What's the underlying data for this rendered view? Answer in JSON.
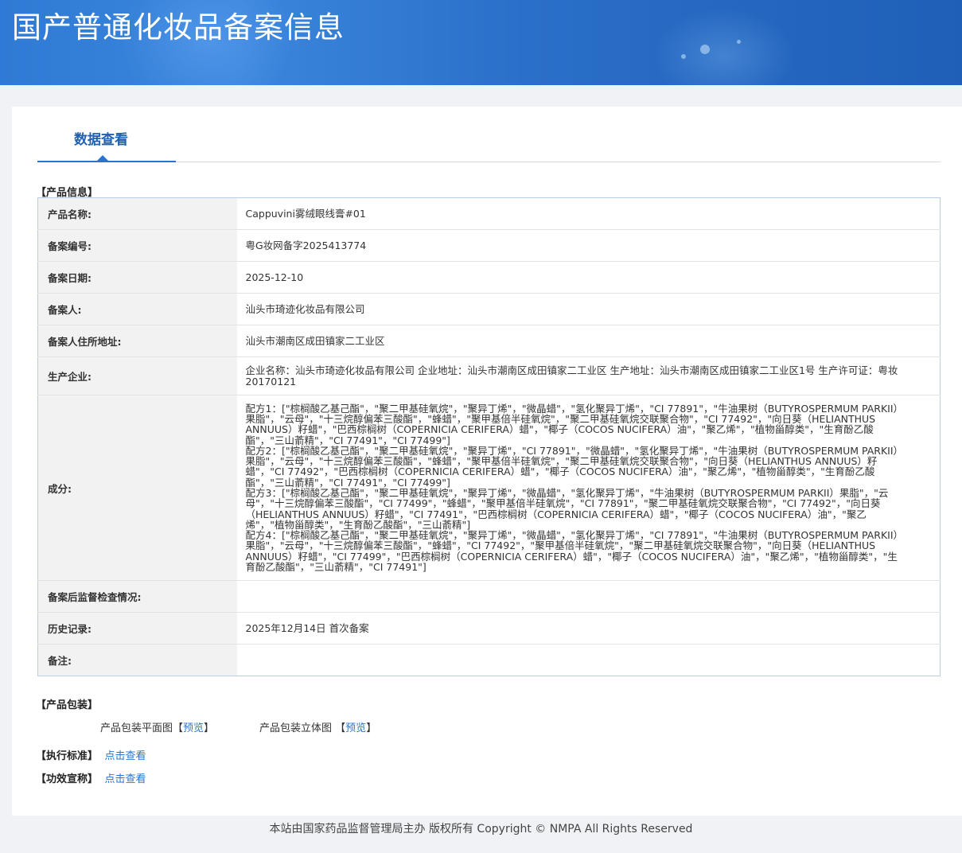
{
  "banner": {
    "title": "国产普通化妆品备案信息"
  },
  "tab": {
    "label": "数据查看"
  },
  "sections": {
    "product_info": "【产品信息】",
    "product_packaging": "【产品包装】",
    "standard": "【执行标准】",
    "efficacy": "【功效宣称】"
  },
  "product_info": {
    "rows": [
      {
        "label": "产品名称:",
        "value": "Cappuvini雾绒眼线膏#01"
      },
      {
        "label": "备案编号:",
        "value": "粤G妆网备字2025413774"
      },
      {
        "label": "备案日期:",
        "value": "2025-12-10"
      },
      {
        "label": "备案人:",
        "value": "汕头市琦迹化妆品有限公司"
      },
      {
        "label": "备案人住所地址:",
        "value": "汕头市潮南区成田镇家二工业区"
      },
      {
        "label": "生产企业:",
        "value": "企业名称：汕头市琦迹化妆品有限公司 企业地址：汕头市潮南区成田镇家二工业区 生产地址：汕头市潮南区成田镇家二工业区1号 生产许可证：粤妆20170121"
      },
      {
        "label": "成分:",
        "value": ""
      },
      {
        "label": "备案后监督检查情况:",
        "value": ""
      },
      {
        "label": "历史记录:",
        "value": "2025年12月14日 首次备案"
      },
      {
        "label": "备注:",
        "value": ""
      }
    ],
    "ingredients": [
      "配方1：[\"棕榈酸乙基己酯\"，\"聚二甲基硅氧烷\"，\"聚异丁烯\"，\"微晶蜡\"，\"氢化聚异丁烯\"，\"CI 77891\"，\"牛油果树（BUTYROSPERMUM PARKII）果脂\"，\"云母\"，\"十三烷醇偏苯三酸酯\"，\"蜂蜡\"，\"聚甲基倍半硅氧烷\"，\"聚二甲基硅氧烷交联聚合物\"，\"CI 77492\"，\"向日葵（HELIANTHUS ANNUUS）籽蜡\"，\"巴西棕榈树（COPERNICIA CERIFERA）蜡\"，\"椰子（COCOS NUCIFERA）油\"，\"聚乙烯\"，\"植物甾醇类\"，\"生育酚乙酸酯\"，\"三山萮精\"，\"CI 77491\"，\"CI 77499\"]",
      "配方2：[\"棕榈酸乙基己酯\"，\"聚二甲基硅氧烷\"，\"聚异丁烯\"，\"CI 77891\"，\"微晶蜡\"，\"氢化聚异丁烯\"，\"牛油果树（BUTYROSPERMUM PARKII）果脂\"，\"云母\"，\"十三烷醇偏苯三酸酯\"，\"蜂蜡\"，\"聚甲基倍半硅氧烷\"，\"聚二甲基硅氧烷交联聚合物\"，\"向日葵（HELIANTHUS ANNUUS）籽蜡\"，\"CI 77492\"，\"巴西棕榈树（COPERNICIA CERIFERA）蜡\"，\"椰子（COCOS NUCIFERA）油\"，\"聚乙烯\"，\"植物甾醇类\"，\"生育酚乙酸酯\"，\"三山萮精\"，\"CI 77491\"，\"CI 77499\"]",
      "配方3：[\"棕榈酸乙基己酯\"，\"聚二甲基硅氧烷\"，\"聚异丁烯\"，\"微晶蜡\"，\"氢化聚异丁烯\"，\"牛油果树（BUTYROSPERMUM PARKII）果脂\"，\"云母\"，\"十三烷醇偏苯三酸酯\"，\"CI 77499\"，\"蜂蜡\"，\"聚甲基倍半硅氧烷\"，\"CI 77891\"，\"聚二甲基硅氧烷交联聚合物\"，\"CI 77492\"，\"向日葵（HELIANTHUS ANNUUS）籽蜡\"，\"CI 77491\"，\"巴西棕榈树（COPERNICIA CERIFERA）蜡\"，\"椰子（COCOS NUCIFERA）油\"，\"聚乙烯\"，\"植物甾醇类\"，\"生育酚乙酸酯\"，\"三山萮精\"]",
      "配方4：[\"棕榈酸乙基己酯\"，\"聚二甲基硅氧烷\"，\"聚异丁烯\"，\"微晶蜡\"，\"氢化聚异丁烯\"，\"CI 77891\"，\"牛油果树（BUTYROSPERMUM PARKII）果脂\"，\"云母\"，\"十三烷醇偏苯三酸酯\"，\"蜂蜡\"，\"CI 77492\"，\"聚甲基倍半硅氧烷\"，\"聚二甲基硅氧烷交联聚合物\"，\"向日葵（HELIANTHUS ANNUUS）籽蜡\"，\"CI 77499\"，\"巴西棕榈树（COPERNICIA CERIFERA）蜡\"，\"椰子（COCOS NUCIFERA）油\"，\"聚乙烯\"，\"植物甾醇类\"，\"生育酚乙酸酯\"，\"三山萮精\"，\"CI 77491\"]"
    ]
  },
  "packaging": {
    "flat_label": "产品包装平面图",
    "flat_link_open": "【",
    "flat_link": "预览",
    "flat_link_close": "】",
    "stereo_label": "产品包装立体图",
    "stereo_link_open": "【",
    "stereo_link": "预览",
    "stereo_link_close": "】"
  },
  "standard_link": "点击查看",
  "efficacy_link": "点击查看",
  "footer": {
    "text": "本站由国家药品监督管理局主办 版权所有 Copyright © NMPA All Rights Reserved"
  }
}
